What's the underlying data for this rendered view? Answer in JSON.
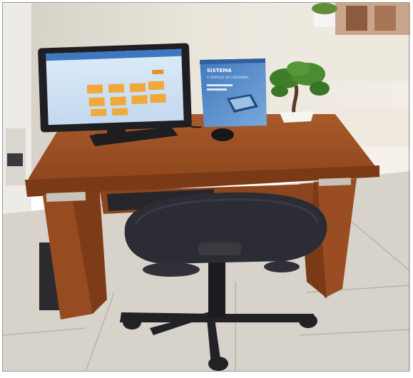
{
  "photo": {
    "subject": "computer-workstation",
    "colors": {
      "wall": "#e7e1d6",
      "floor": "#d9d6cf",
      "desk_wood": "#9a4f24",
      "desk_dark": "#6e3515",
      "chair": "#2c2c34",
      "monitor_screen": "#cfe2f3",
      "screen_tiles": "#f0a93a",
      "sign_panel": "#5c8fc8",
      "plant_green": "#3f7d2a"
    }
  },
  "sign": {
    "title": "SISTEMA",
    "subtitle": "A SERVIÇO DA CIDADANIA"
  },
  "monitor": {
    "tiles": 10
  }
}
